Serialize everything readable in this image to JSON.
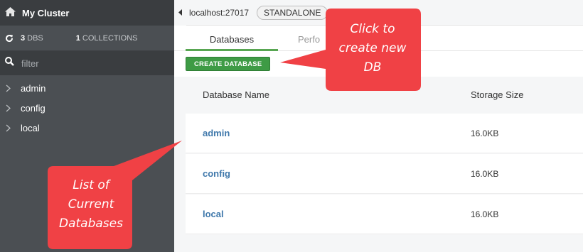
{
  "sidebar": {
    "cluster_name": "My Cluster",
    "dbs_count": "3",
    "dbs_label": "DBS",
    "collections_count": "1",
    "collections_label": "COLLECTIONS",
    "filter_placeholder": "filter",
    "databases": [
      {
        "label": "admin"
      },
      {
        "label": "config"
      },
      {
        "label": "local"
      }
    ]
  },
  "topbar": {
    "host": "localhost:27017",
    "topology": "STANDALONE"
  },
  "tabs": [
    {
      "label": "Databases",
      "active": true
    },
    {
      "label": "Perfo",
      "active": false
    }
  ],
  "toolbar": {
    "create_label": "CREATE DATABASE"
  },
  "table": {
    "headers": {
      "name": "Database Name",
      "size": "Storage Size"
    },
    "rows": [
      {
        "name": "admin",
        "size": "16.0KB"
      },
      {
        "name": "config",
        "size": "16.0KB"
      },
      {
        "name": "local",
        "size": "16.0KB"
      }
    ]
  },
  "callouts": {
    "create": [
      "Click to",
      "create new",
      "DB"
    ],
    "list": [
      "List of",
      "Current",
      "Databases"
    ]
  },
  "colors": {
    "sidebar_bg": "#4b4f53",
    "sidebar_dark": "#3a3d40",
    "accent_green": "#3e9b45",
    "link_blue": "#3f78ab",
    "callout_red": "#f04145"
  }
}
